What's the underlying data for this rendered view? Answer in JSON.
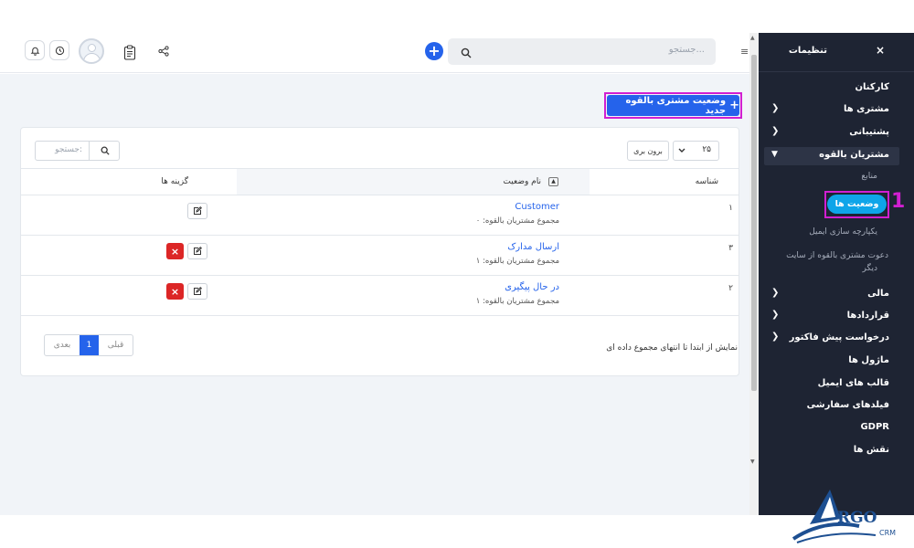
{
  "header": {
    "search_placeholder": "جستجو...",
    "icons": [
      "bell-icon",
      "clock-icon",
      "avatar",
      "clipboard-icon",
      "share-icon",
      "add-icon",
      "search-icon",
      "menu-icon"
    ]
  },
  "toolbar": {
    "new_button_label": "وضعیت مشتری بالقوه جدید"
  },
  "table": {
    "search_placeholder": "جستجو:",
    "page_size": "۲۵",
    "export_label": "برون بری",
    "columns": {
      "id": "شناسه",
      "status_name": "نام وضعیت",
      "options": "گزینه ها"
    },
    "rows": [
      {
        "id": "۱",
        "name": "Customer",
        "sub": "مجموع مشتریان بالقوه: ۰",
        "deletable": false
      },
      {
        "id": "۳",
        "name": "ارسال مدارک",
        "sub": "مجموع مشتریان بالقوه: ۱",
        "deletable": true
      },
      {
        "id": "۲",
        "name": "در حال پیگیری",
        "sub": "مجموع مشتریان بالقوه: ۱",
        "deletable": true
      }
    ],
    "info": "نمایش از ابتدا تا انتهای مجموع داده ای",
    "pager": {
      "prev": "قبلی",
      "current": "1",
      "next": "بعدی"
    }
  },
  "sidebar": {
    "title": "تنظیمات",
    "close_symbol": "×",
    "items": [
      {
        "label": "کارکنان"
      },
      {
        "label": "مشتری ها"
      },
      {
        "label": "پشتیبانی"
      },
      {
        "label": "مشتریان بالقوه"
      },
      {
        "label": "مالی"
      },
      {
        "label": "قراردادها"
      },
      {
        "label": "درخواست پیش فاکتور"
      },
      {
        "label": "ماژول ها"
      },
      {
        "label": "قالب های ایمیل"
      },
      {
        "label": "فیلدهای سفارشی"
      },
      {
        "label": "GDPR"
      },
      {
        "label": "نقش ها"
      }
    ],
    "sub_items": [
      {
        "label": "منابع"
      },
      {
        "label": "وضعیت ها"
      },
      {
        "label": "یکپارچه سازی ایمیل"
      },
      {
        "label": "دعوت مشتری بالقوه از سایت"
      },
      {
        "label": "دیگر"
      }
    ],
    "annotation_number": "1"
  },
  "logo": {
    "text": "RGO",
    "sub": "CRM"
  },
  "colors": {
    "accent": "#2563eb",
    "sidebar": "#1e2433",
    "danger": "#dc2626",
    "highlight": "#d11fd1",
    "pill": "#0ea5e9"
  }
}
